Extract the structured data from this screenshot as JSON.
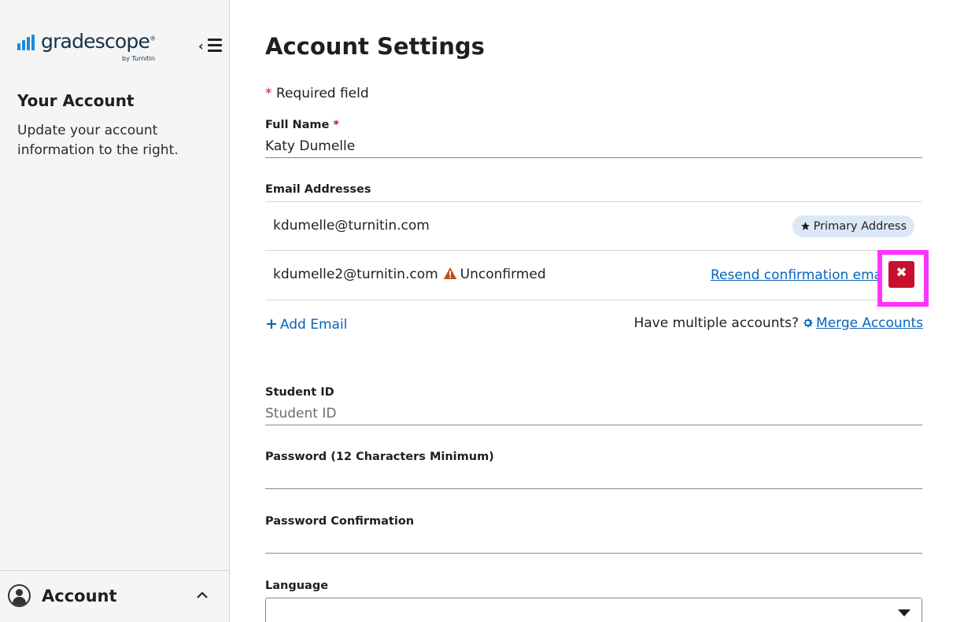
{
  "sidebar": {
    "logo_text": "gradescope",
    "logo_tm": "®",
    "logo_byline": "by Turnitin",
    "section_title": "Your Account",
    "section_description": "Update your account information to the right.",
    "account_menu_label": "Account"
  },
  "main": {
    "title": "Account Settings",
    "required_star": "*",
    "required_note": "Required field",
    "full_name": {
      "label": "Full Name",
      "value": "Katy Dumelle"
    },
    "email_addresses": {
      "label": "Email Addresses",
      "rows": [
        {
          "email": "kdumelle@turnitin.com",
          "badge": "Primary Address"
        },
        {
          "email": "kdumelle2@turnitin.com",
          "status": "Unconfirmed",
          "resend_label": "Resend confirmation email",
          "remove_symbol": "✖"
        }
      ],
      "add_email_plus": "+",
      "add_email_label": "Add Email",
      "merge_prompt": "Have multiple accounts?",
      "merge_label": "Merge Accounts"
    },
    "student_id": {
      "label": "Student ID",
      "placeholder": "Student ID"
    },
    "password": {
      "label": "Password (12 Characters Minimum)"
    },
    "password_confirmation": {
      "label": "Password Confirmation"
    },
    "language": {
      "label": "Language"
    }
  },
  "colors": {
    "link": "#0a63b8",
    "danger": "#c8102e",
    "badge_bg": "#dbe9f7",
    "highlight": "#ff33ff",
    "warning": "#c0501a"
  }
}
